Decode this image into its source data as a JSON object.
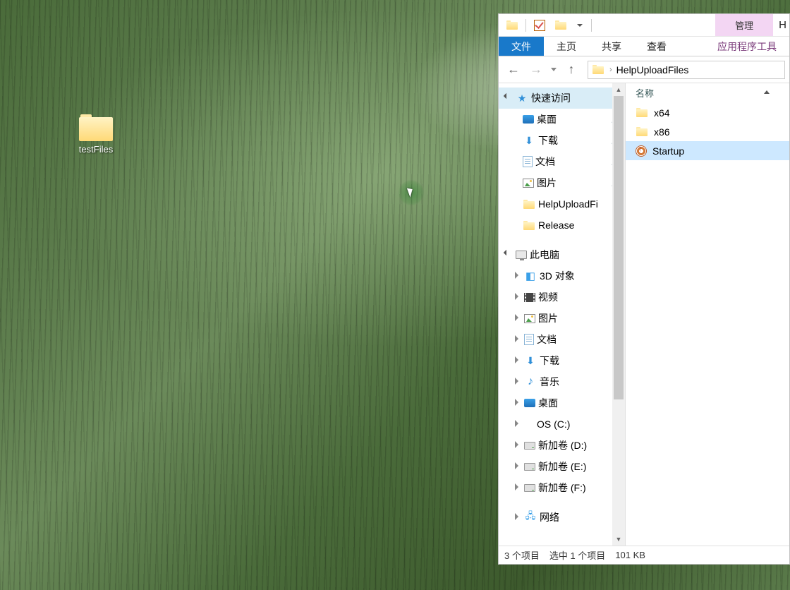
{
  "desktop": {
    "icon_label": "testFiles"
  },
  "titlebar": {
    "manage_label": "管理",
    "trailing_char": "H"
  },
  "ribbon": {
    "file": "文件",
    "home": "主页",
    "share": "共享",
    "view": "查看",
    "app_tools": "应用程序工具"
  },
  "address": {
    "location": "HelpUploadFiles"
  },
  "nav": {
    "quick_access": "快速访问",
    "desktop": "桌面",
    "downloads": "下载",
    "documents": "文档",
    "pictures": "图片",
    "help_upload": "HelpUploadFi",
    "release": "Release",
    "this_pc": "此电脑",
    "objects3d": "3D 对象",
    "videos": "视频",
    "pictures2": "图片",
    "documents2": "文档",
    "downloads2": "下载",
    "music": "音乐",
    "desktop2": "桌面",
    "os_c": "OS (C:)",
    "vol_d": "新加卷 (D:)",
    "vol_e": "新加卷 (E:)",
    "vol_f": "新加卷 (F:)",
    "network": "网络"
  },
  "columns": {
    "name": "名称"
  },
  "files": {
    "x64": "x64",
    "x86": "x86",
    "startup": "Startup"
  },
  "status": {
    "items": "3 个项目",
    "selected": "选中 1 个项目",
    "size": "101 KB"
  }
}
